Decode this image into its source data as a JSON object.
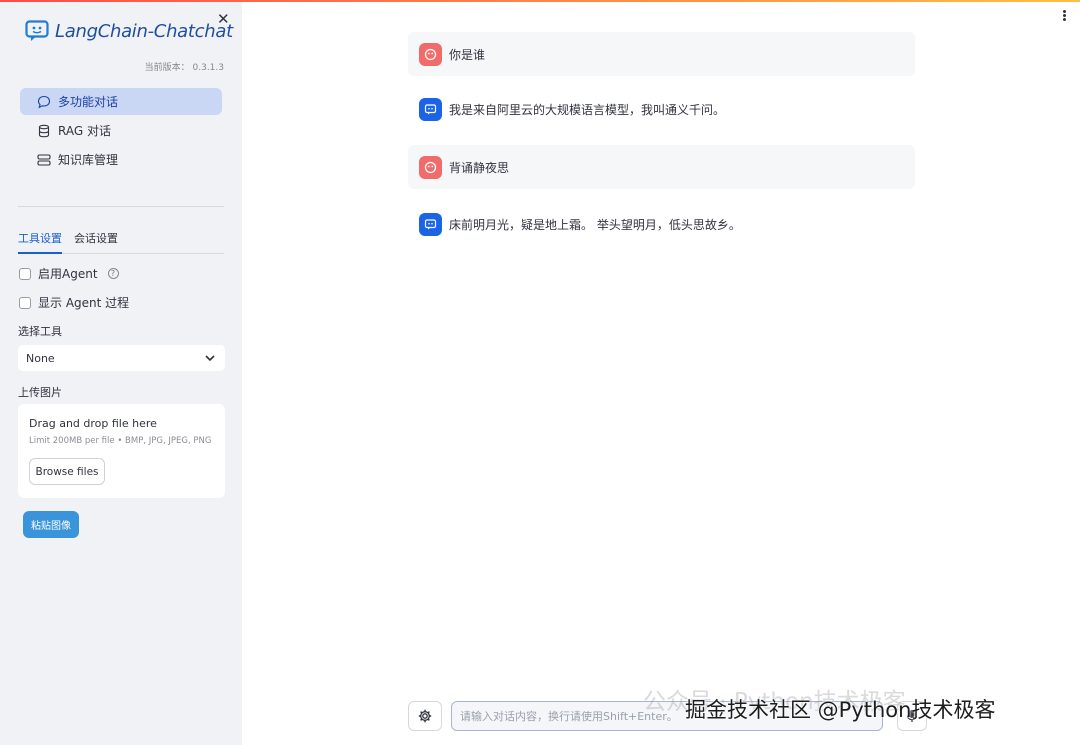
{
  "app": {
    "logo_text": "LangChain-Chatchat",
    "version_text": "当前版本： 0.3.1.3"
  },
  "sidebar": {
    "close_icon": "close-icon",
    "menu": [
      {
        "label": "多功能对话",
        "icon": "chat-bubble-icon",
        "active": true
      },
      {
        "label": "RAG 对话",
        "icon": "database-icon",
        "active": false
      },
      {
        "label": "知识库管理",
        "icon": "server-stack-icon",
        "active": false
      }
    ],
    "tabs": [
      {
        "label": "工具设置",
        "active": true
      },
      {
        "label": "会话设置",
        "active": false
      }
    ],
    "enable_agent_label": "启用Agent",
    "show_agent_label": "显示 Agent 过程",
    "select_tool_label": "选择工具",
    "select_tool_value": "None",
    "upload_label": "上传图片",
    "upload": {
      "drop_title": "Drag and drop file here",
      "limit": "Limit 200MB per file • BMP, JPG, JPEG, PNG",
      "browse_label": "Browse files"
    },
    "paste_label": "粘贴图像"
  },
  "chat": {
    "messages": [
      {
        "role": "user",
        "text": "你是谁"
      },
      {
        "role": "assistant",
        "text": "我是来自阿里云的大规模语言模型，我叫通义千问。"
      },
      {
        "role": "user",
        "text": "背诵静夜思"
      },
      {
        "role": "assistant",
        "text": "床前明月光，疑是地上霜。 举头望明月，低头思故乡。"
      }
    ],
    "input_placeholder": "请输入对话内容，换行请使用Shift+Enter。"
  },
  "watermark": {
    "faint": "公众号 · Python技术极客",
    "main": "掘金技术社区 @Python技术极客"
  },
  "colors": {
    "accent": "#1a5fd1",
    "active_menu_bg": "#c9d7f5",
    "user_avatar": "#f26b6b",
    "ai_avatar": "#1c64e6",
    "paste_button": "#3a94d9"
  }
}
